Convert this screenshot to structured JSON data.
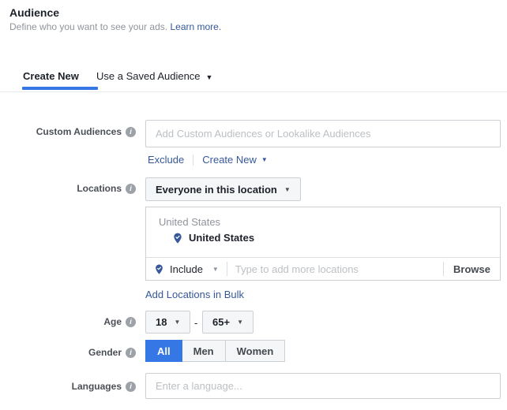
{
  "header": {
    "title": "Audience",
    "subtitle": "Define who you want to see your ads.",
    "learn_more_link": "Learn more."
  },
  "tabs": {
    "create_new": "Create New",
    "use_saved_audience": "Use a Saved Audience"
  },
  "custom_audiences": {
    "label": "Custom Audiences",
    "placeholder": "Add Custom Audiences or Lookalike Audiences",
    "exclude_link": "Exclude",
    "create_new_link": "Create New"
  },
  "locations": {
    "label": "Locations",
    "scope_dropdown": "Everyone in this location",
    "group_header": "United States",
    "selected_location": "United States",
    "include_dropdown": "Include",
    "add_placeholder": "Type to add more locations",
    "browse_button": "Browse",
    "bulk_link": "Add Locations in Bulk"
  },
  "age": {
    "label": "Age",
    "min": "18",
    "separator": "-",
    "max": "65+"
  },
  "gender": {
    "label": "Gender",
    "options": [
      "All",
      "Men",
      "Women"
    ],
    "selected": "All"
  },
  "languages": {
    "label": "Languages",
    "placeholder": "Enter a language..."
  },
  "icons": {
    "info": "i",
    "caret_down": "▼"
  },
  "colors": {
    "accent_blue": "#3578e5",
    "link_blue": "#365899",
    "pin_blue": "#365899",
    "border_gray": "#ccd0d5",
    "button_bg": "#f5f6f7",
    "muted_text": "#90949c",
    "placeholder_text": "#bcc0c4"
  }
}
